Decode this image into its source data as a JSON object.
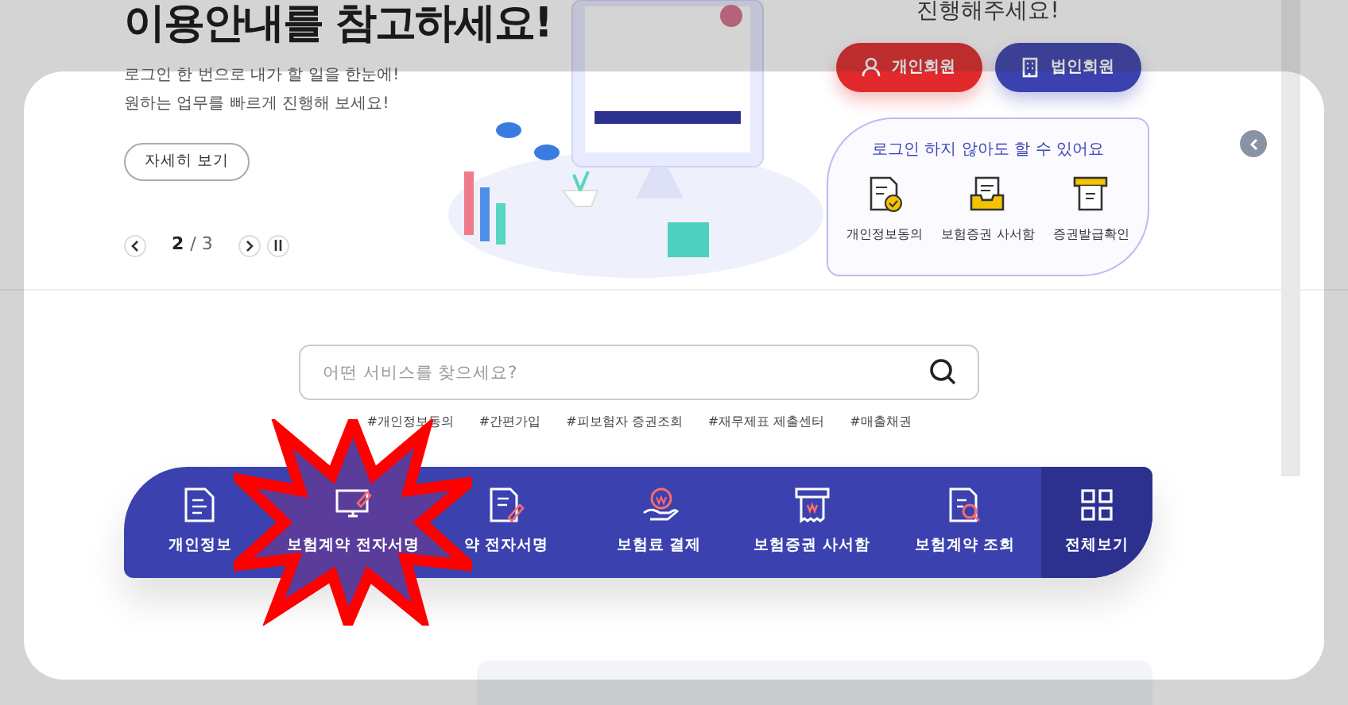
{
  "hero": {
    "headline": "이용안내를 참고하세요!",
    "lines": [
      "로그인 한 번으로 내가 할 일을 한눈에!",
      "원하는 업무를 빠르게 진행해 보세요!"
    ],
    "more_button": "자세히 보기",
    "pager": {
      "current": "2",
      "total": "/ 3"
    }
  },
  "login": {
    "heading": "진행해주세요!",
    "buttons": [
      {
        "label": "개인회원",
        "kind": "person"
      },
      {
        "label": "법인회원",
        "kind": "building"
      }
    ],
    "guest": {
      "title": "로그인 하지 않아도 할 수 있어요",
      "items": [
        {
          "label": "개인정보동의",
          "kind": "consent"
        },
        {
          "label": "보험증권 사서함",
          "kind": "inbox"
        },
        {
          "label": "증권발급확인",
          "kind": "receipt"
        }
      ]
    }
  },
  "search": {
    "placeholder": "어떤 서비스를 찾으세요?",
    "tags": [
      "#개인정보동의",
      "#간편가입",
      "#피보험자 증권조회",
      "#재무제표 제출센터",
      "#매출채권"
    ]
  },
  "services": [
    {
      "label": "개인정보",
      "kind": "doc",
      "selected": false
    },
    {
      "label": "보험계약 전자서명",
      "kind": "monitor",
      "selected": true
    },
    {
      "label": "약 전자서명",
      "kind": "docpen",
      "selected": false
    },
    {
      "label": "보험료 결제",
      "kind": "hand",
      "selected": false
    },
    {
      "label": "보험증권 사서함",
      "kind": "receipt",
      "selected": false
    },
    {
      "label": "보험계약 조회",
      "kind": "docsearch",
      "selected": false
    },
    {
      "label": "전체보기",
      "kind": "all",
      "selected": false
    }
  ]
}
